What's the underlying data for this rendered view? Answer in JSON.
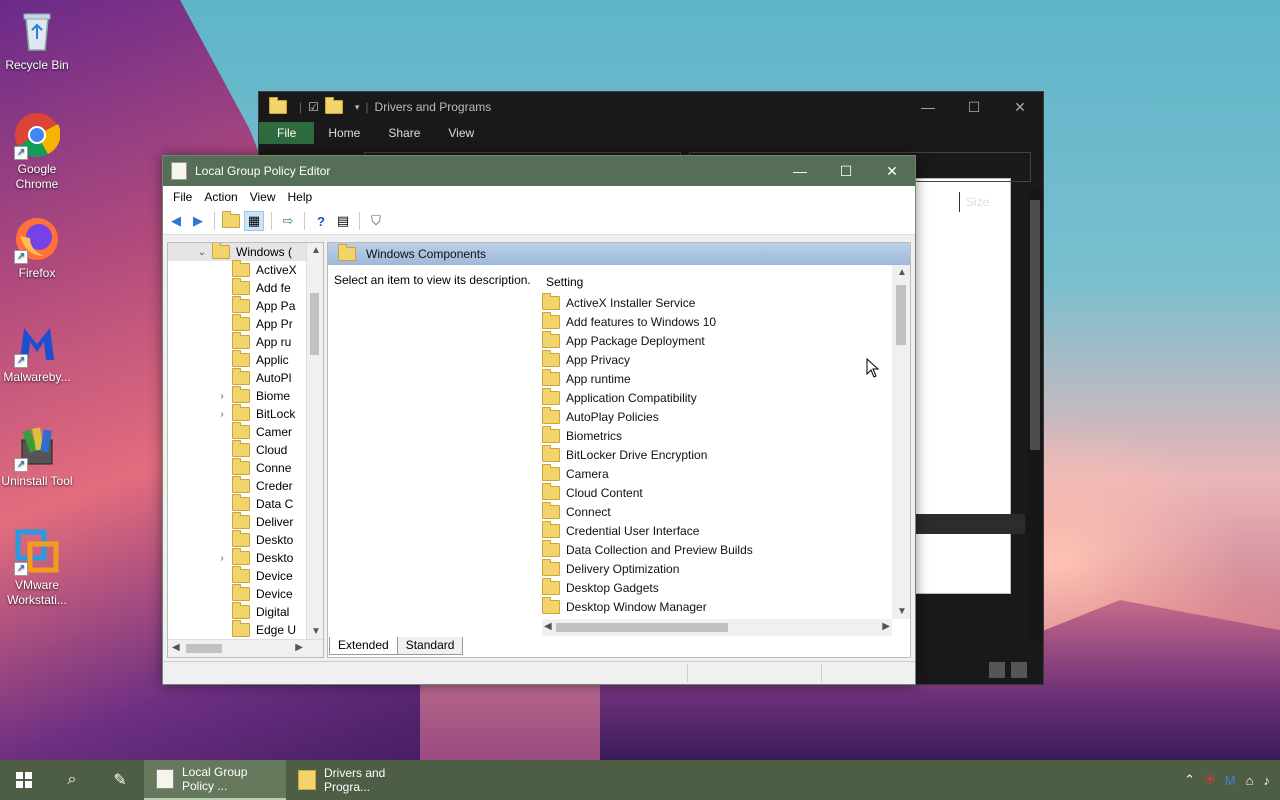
{
  "desktop": {
    "icons": [
      {
        "label": "Recycle Bin"
      },
      {
        "label": "Google Chrome"
      },
      {
        "label": "Firefox"
      },
      {
        "label": "Malwareby..."
      },
      {
        "label": "Uninstall Tool"
      },
      {
        "label": "VMware Workstati..."
      }
    ]
  },
  "explorer": {
    "title": "Drivers and Programs",
    "tabs": [
      "File",
      "Home",
      "Share",
      "View"
    ],
    "column_size": "Size"
  },
  "gpe": {
    "title": "Local Group Policy Editor",
    "menu": [
      "File",
      "Action",
      "View",
      "Help"
    ],
    "tree_items": [
      {
        "label": "Windows (",
        "expand": "v"
      },
      {
        "label": "ActiveX",
        "expand": ""
      },
      {
        "label": "Add fe",
        "expand": ""
      },
      {
        "label": "App Pa",
        "expand": ""
      },
      {
        "label": "App Pr",
        "expand": ""
      },
      {
        "label": "App ru",
        "expand": ""
      },
      {
        "label": "Applic",
        "expand": ""
      },
      {
        "label": "AutoPl",
        "expand": ""
      },
      {
        "label": "Biome",
        "expand": ">"
      },
      {
        "label": "BitLock",
        "expand": ">"
      },
      {
        "label": "Camer",
        "expand": ""
      },
      {
        "label": "Cloud",
        "expand": ""
      },
      {
        "label": "Conne",
        "expand": ""
      },
      {
        "label": "Creder",
        "expand": ""
      },
      {
        "label": "Data C",
        "expand": ""
      },
      {
        "label": "Deliver",
        "expand": ""
      },
      {
        "label": "Deskto",
        "expand": ""
      },
      {
        "label": "Deskto",
        "expand": ">"
      },
      {
        "label": "Device",
        "expand": ""
      },
      {
        "label": "Device",
        "expand": ""
      },
      {
        "label": "Digital",
        "expand": ""
      },
      {
        "label": "Edge U",
        "expand": ""
      }
    ],
    "header": "Windows Components",
    "description": "Select an item to view its description.",
    "list_header": "Setting",
    "settings": [
      "ActiveX Installer Service",
      "Add features to Windows 10",
      "App Package Deployment",
      "App Privacy",
      "App runtime",
      "Application Compatibility",
      "AutoPlay Policies",
      "Biometrics",
      "BitLocker Drive Encryption",
      "Camera",
      "Cloud Content",
      "Connect",
      "Credential User Interface",
      "Data Collection and Preview Builds",
      "Delivery Optimization",
      "Desktop Gadgets",
      "Desktop Window Manager"
    ],
    "bottom_tabs": [
      "Extended",
      "Standard"
    ]
  },
  "taskbar": {
    "tasks": [
      {
        "label": "Local Group Policy ..."
      },
      {
        "label": "Drivers and Progra..."
      }
    ]
  }
}
